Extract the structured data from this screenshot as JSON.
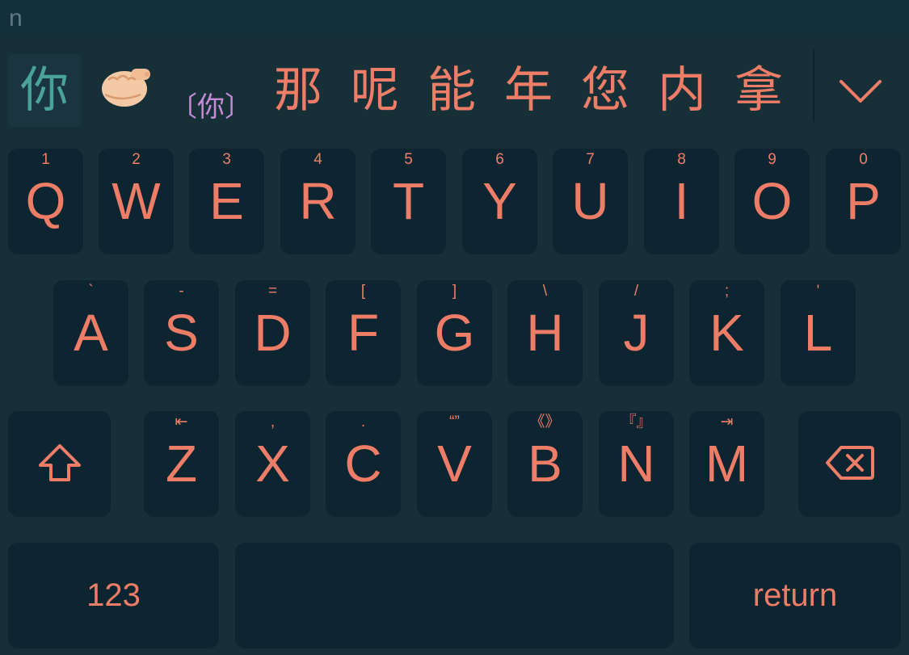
{
  "preedit": {
    "text": "n"
  },
  "candidates": {
    "first": "你",
    "emoji": "👊",
    "emoji_icon": "pointing-fist-emoji",
    "paren": "〔你〕",
    "items": [
      "那",
      "呢",
      "能",
      "年",
      "您",
      "内",
      "拿"
    ],
    "expand_icon": "chevron-down-icon"
  },
  "colors": {
    "background": "#173038",
    "key": "#0c2530",
    "label": "#ee7d68",
    "first_candidate": "#4aa39a",
    "paren_candidate": "#c68bd6"
  },
  "rows": {
    "row1": [
      {
        "main": "Q",
        "sub": "1"
      },
      {
        "main": "W",
        "sub": "2"
      },
      {
        "main": "E",
        "sub": "3"
      },
      {
        "main": "R",
        "sub": "4"
      },
      {
        "main": "T",
        "sub": "5"
      },
      {
        "main": "Y",
        "sub": "6"
      },
      {
        "main": "U",
        "sub": "7"
      },
      {
        "main": "I",
        "sub": "8"
      },
      {
        "main": "O",
        "sub": "9"
      },
      {
        "main": "P",
        "sub": "0"
      }
    ],
    "row2": [
      {
        "main": "A",
        "sub": "`"
      },
      {
        "main": "S",
        "sub": "-"
      },
      {
        "main": "D",
        "sub": "="
      },
      {
        "main": "F",
        "sub": "["
      },
      {
        "main": "G",
        "sub": "]"
      },
      {
        "main": "H",
        "sub": "\\"
      },
      {
        "main": "J",
        "sub": "/"
      },
      {
        "main": "K",
        "sub": ";"
      },
      {
        "main": "L",
        "sub": "'"
      }
    ],
    "row3": [
      {
        "main": "Z",
        "sub": "⇤"
      },
      {
        "main": "X",
        "sub": ","
      },
      {
        "main": "C",
        "sub": "."
      },
      {
        "main": "V",
        "sub": "“”"
      },
      {
        "main": "B",
        "sub": "《》"
      },
      {
        "main": "N",
        "sub": "『』"
      },
      {
        "main": "M",
        "sub": "⇥"
      }
    ]
  },
  "keys": {
    "shift_icon": "shift-icon",
    "backspace_icon": "backspace-icon",
    "numbers_label": "123",
    "return_label": "return"
  }
}
